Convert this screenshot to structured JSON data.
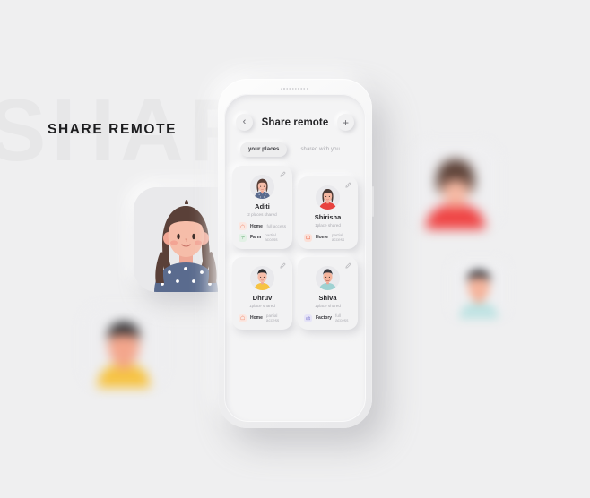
{
  "page": {
    "watermark_text": "SHARE",
    "headline": "SHARE REMOTE",
    "background_color": "#efeff0"
  },
  "phone": {
    "screen_color": "#f4f4f5",
    "frame_color": "#f2f2f3"
  },
  "app": {
    "header": {
      "back_label": "‹",
      "title": "Share remote",
      "add_label": "+"
    },
    "tabs": [
      {
        "label": "your places",
        "active": true
      },
      {
        "label": "shared with you",
        "active": false
      }
    ],
    "cards": [
      {
        "name": "Aditi",
        "subtitle": "2 places shared",
        "avatar": "female-brown-hair-denim",
        "edit_icon": "pencil-icon",
        "places": [
          {
            "icon": "home-icon",
            "icon_color": "#f3a58f",
            "icon_bg": "#fbe7e1",
            "name": "Home",
            "access": "full access"
          },
          {
            "icon": "farm-icon",
            "icon_color": "#8fc49b",
            "icon_bg": "#e3f1e6",
            "name": "Farm",
            "access": "partial access"
          }
        ]
      },
      {
        "name": "Shirisha",
        "subtitle": "1place shared",
        "avatar": "female-red-top",
        "edit_icon": "pencil-icon",
        "places": [
          {
            "icon": "home-icon",
            "icon_color": "#ef7a5e",
            "icon_bg": "#fbe0d8",
            "name": "Home",
            "access": "partial access"
          }
        ]
      },
      {
        "name": "Dhruv",
        "subtitle": "1place shared",
        "avatar": "male-yellow-top",
        "edit_icon": "pencil-icon",
        "places": [
          {
            "icon": "home-icon",
            "icon_color": "#f3a58f",
            "icon_bg": "#fbe7e1",
            "name": "Home",
            "access": "partial access"
          }
        ]
      },
      {
        "name": "Shiva",
        "subtitle": "1place shared",
        "avatar": "male-teal-top",
        "edit_icon": "pencil-icon",
        "places": [
          {
            "icon": "factory-icon",
            "icon_color": "#8e8ad6",
            "icon_bg": "#e6e4f7",
            "name": "Factory",
            "access": "full access"
          }
        ]
      }
    ]
  },
  "decorations": {
    "hero_avatar": {
      "name": "hero-avatar-female",
      "card_color": "#e9e9eb"
    },
    "floating_avatars": [
      {
        "name": "floating-avatar-yellow",
        "shirt_color": "#f6c343",
        "hair_color": "#2b2b2e"
      },
      {
        "name": "floating-avatar-red",
        "shirt_color": "#ef4444",
        "hair_color": "#4b3b36"
      },
      {
        "name": "floating-avatar-teal",
        "shirt_color": "#bfe3e3",
        "hair_color": "#3a3a40"
      }
    ]
  }
}
